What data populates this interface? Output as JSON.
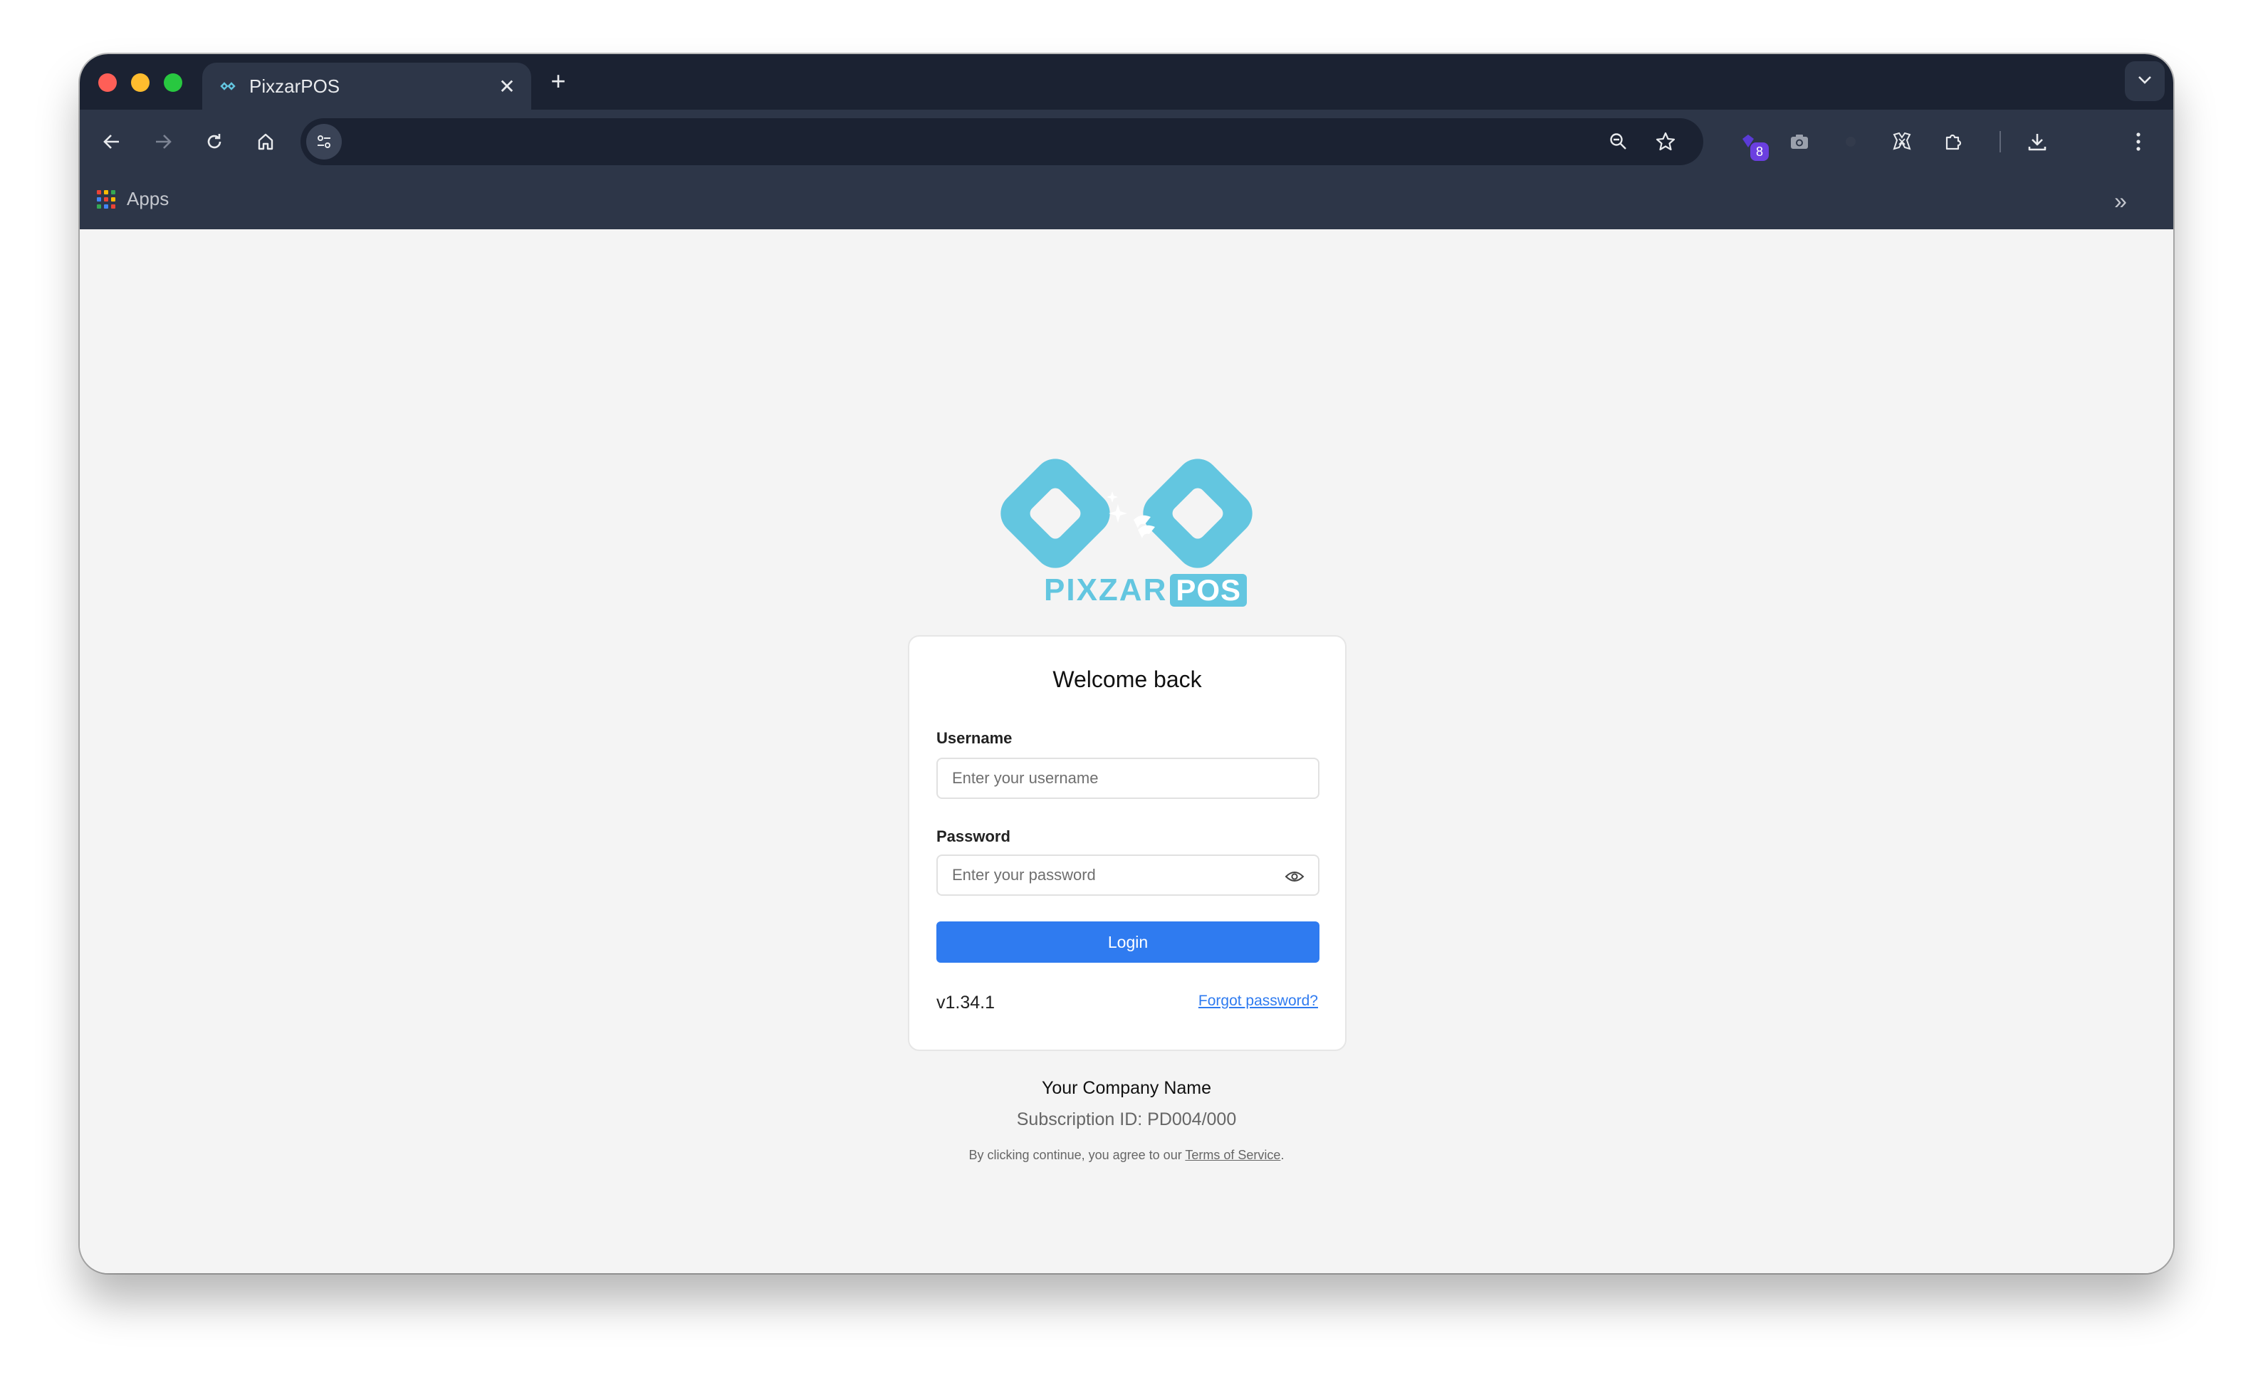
{
  "browser": {
    "tab": {
      "title": "PixzarPOS",
      "close_glyph": "✕"
    },
    "new_tab_glyph": "+",
    "bookmarks": {
      "apps_label": "Apps",
      "more_glyph": "»"
    },
    "extensions": {
      "badge_count": "8"
    }
  },
  "login": {
    "logo": {
      "word_primary": "PIXZAR",
      "word_secondary": "POS",
      "color": "#63c6e0"
    },
    "title": "Welcome back",
    "username": {
      "label": "Username",
      "placeholder": "Enter your username",
      "value": ""
    },
    "password": {
      "label": "Password",
      "placeholder": "Enter your password",
      "value": ""
    },
    "login_button": "Login",
    "version": "v1.34.1",
    "forgot_password": "Forgot password?"
  },
  "footer": {
    "company": "Your Company Name",
    "subscription": "Subscription ID: PD004/000",
    "terms_prefix": "By clicking continue, you agree to our ",
    "terms_link": "Terms of Service",
    "terms_suffix": "."
  },
  "colors": {
    "accent": "#2f7bf0",
    "chrome_dark": "#1b2232",
    "chrome_mid": "#2d3648",
    "page_bg": "#f4f4f4"
  }
}
